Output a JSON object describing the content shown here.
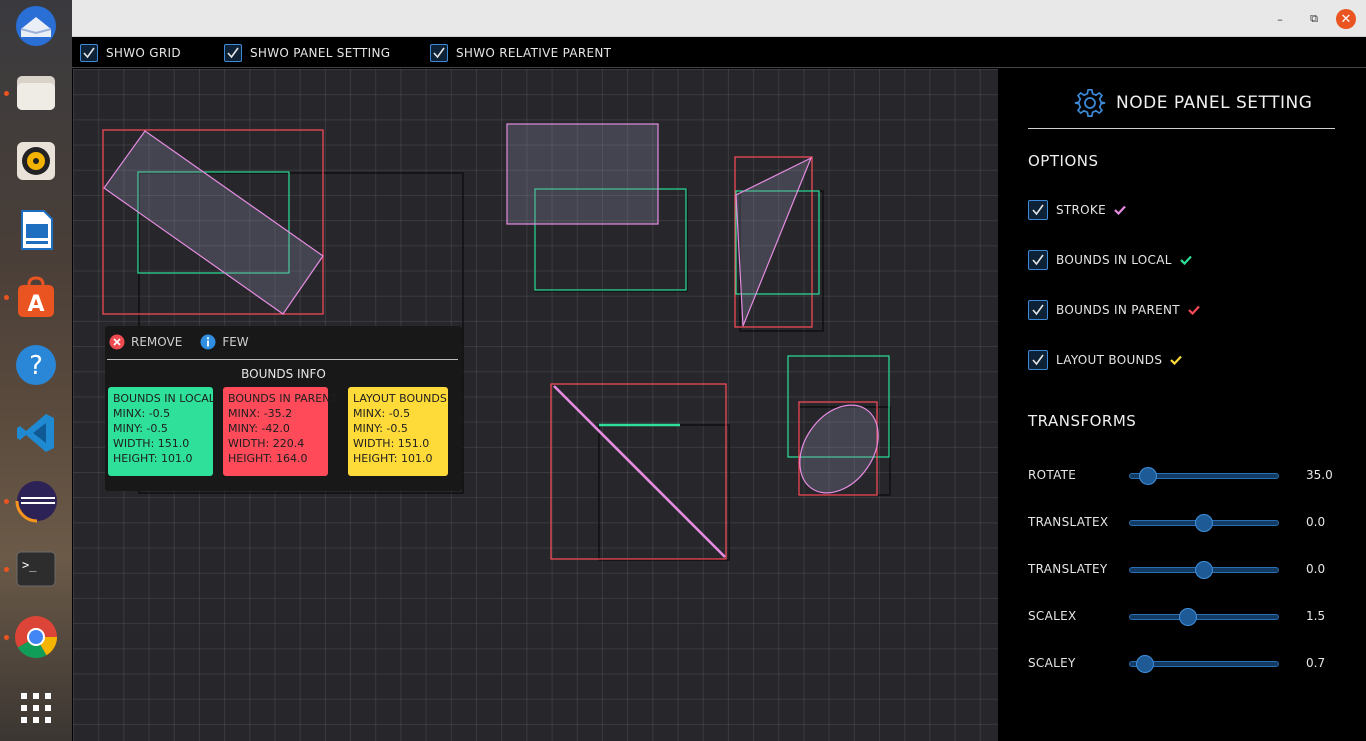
{
  "dock": {
    "items": [
      {
        "name": "thunderbird-icon"
      },
      {
        "name": "files-icon"
      },
      {
        "name": "rhythmbox-icon"
      },
      {
        "name": "libreoffice-writer-icon"
      },
      {
        "name": "software-center-icon"
      },
      {
        "name": "help-icon",
        "glyph": "?"
      },
      {
        "name": "vscode-icon"
      },
      {
        "name": "eclipse-icon"
      },
      {
        "name": "terminal-icon",
        "glyph": ">_"
      },
      {
        "name": "chrome-icon"
      },
      {
        "name": "app-grid-icon"
      }
    ]
  },
  "titlebar": {
    "minimize": "–",
    "restore": "⧉",
    "close": "✕"
  },
  "toolbar": {
    "options": [
      {
        "label": "SHWO GRID",
        "checked": true
      },
      {
        "label": "SHWO PANEL SETTING",
        "checked": true
      },
      {
        "label": "SHWO RELATIVE PARENT",
        "checked": true
      }
    ]
  },
  "info_popup": {
    "remove_label": "REMOVE",
    "few_label": "FEW",
    "title": "BOUNDS INFO",
    "cards": [
      {
        "title": "BOUNDS IN LOCAL",
        "color": "#2ee09a",
        "lines": [
          "MINX: -0.5",
          "MINY: -0.5",
          "WIDTH: 151.0",
          "HEIGHT: 101.0"
        ]
      },
      {
        "title": "BOUNDS IN PARENT",
        "color": "#ff4a5a",
        "lines": [
          "MINX: -35.2",
          "MINY: -42.0",
          "WIDTH: 220.4",
          "HEIGHT: 164.0"
        ]
      },
      {
        "title": "LAYOUT BOUNDS",
        "color": "#ffdb3a",
        "lines": [
          "MINX: -0.5",
          "MINY: -0.5",
          "WIDTH: 151.0",
          "HEIGHT: 101.0"
        ]
      }
    ]
  },
  "panel": {
    "title": "NODE PANEL SETTING",
    "options_title": "OPTIONS",
    "options": [
      {
        "label": "STROKE",
        "checked": true,
        "mark_color": "#e58ce0"
      },
      {
        "label": "BOUNDS IN LOCAL",
        "checked": true,
        "mark_color": "#2ee09a"
      },
      {
        "label": "BOUNDS IN PARENT",
        "checked": true,
        "mark_color": "#ff4a5a"
      },
      {
        "label": "LAYOUT BOUNDS",
        "checked": true,
        "mark_color": "#ffdb3a"
      }
    ],
    "transforms_title": "TRANSFORMS",
    "sliders": [
      {
        "label": "ROTATE",
        "value": "35.0",
        "fraction": 0.12
      },
      {
        "label": "TRANSLATEX",
        "value": "0.0",
        "fraction": 0.5
      },
      {
        "label": "TRANSLATEY",
        "value": "0.0",
        "fraction": 0.5
      },
      {
        "label": "SCALEX",
        "value": "1.5",
        "fraction": 0.39
      },
      {
        "label": "SCALEY",
        "value": "0.7",
        "fraction": 0.1
      }
    ]
  },
  "colors": {
    "accent": "#3c8ad8",
    "stroke": "#e58ce0",
    "local": "#2ee09a",
    "parent": "#ff4a5a",
    "layout": "#ffdb3a"
  }
}
